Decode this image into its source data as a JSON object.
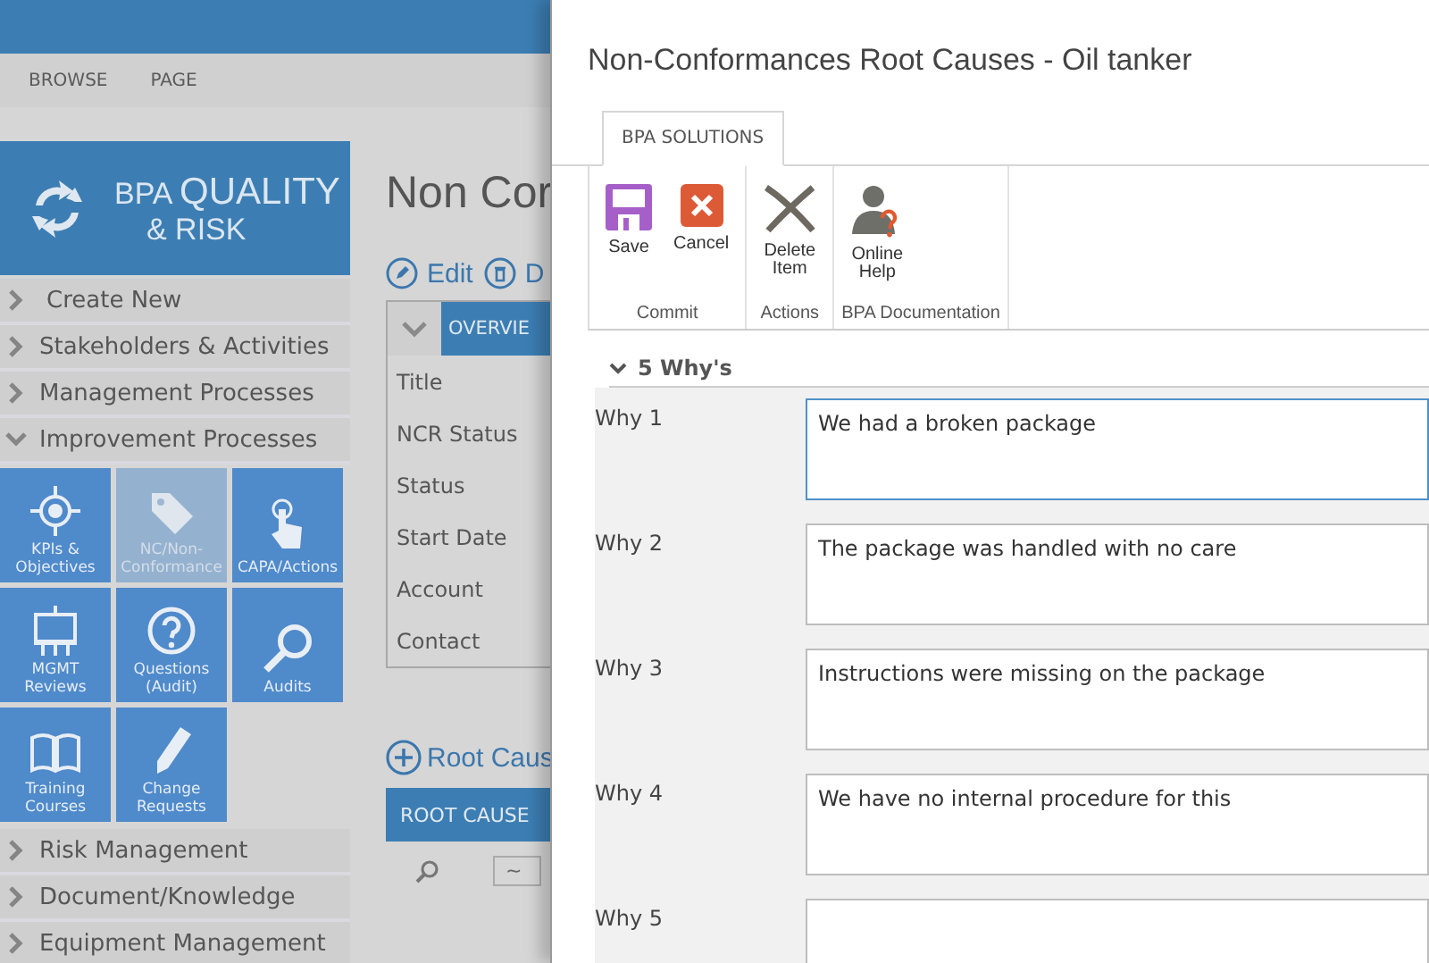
{
  "top_tabs": [
    "BROWSE",
    "PAGE"
  ],
  "logo": {
    "line1a": "BPA",
    "line1b": "QUALITY",
    "line2": "& RISK"
  },
  "nav_top": [
    {
      "label": "Create New",
      "expanded": false
    },
    {
      "label": "Stakeholders & Activities",
      "expanded": false
    },
    {
      "label": "Management Processes",
      "expanded": false
    },
    {
      "label": "Improvement Processes",
      "expanded": true
    }
  ],
  "tiles": [
    {
      "label": "KPIs & Objectives",
      "selected": false
    },
    {
      "label": "NC/Non-Conformance",
      "selected": true
    },
    {
      "label": "CAPA/Actions",
      "selected": false
    },
    {
      "label": "MGMT Reviews",
      "selected": false
    },
    {
      "label": "Questions (Audit)",
      "selected": false
    },
    {
      "label": "Audits",
      "selected": false
    },
    {
      "label": "Training Courses",
      "selected": false
    },
    {
      "label": "Change Requests",
      "selected": false
    }
  ],
  "nav_bottom": [
    {
      "label": "Risk Management",
      "expanded": false
    },
    {
      "label": "Document/Knowledge",
      "expanded": false
    },
    {
      "label": "Equipment Management",
      "expanded": false
    }
  ],
  "page": {
    "title": "Non Cor",
    "actions": [
      "Edit",
      "D"
    ],
    "section": "OVERVIE",
    "fields": [
      "Title",
      "NCR Status",
      "Status",
      "Start Date",
      "Account",
      "Contact"
    ],
    "add_link": "Root Caus",
    "list_header": "ROOT CAUSE",
    "filter_value": "~"
  },
  "dialog": {
    "title": "Non-Conformances Root Causes - Oil tanker",
    "ribbon_tab": "BPA SOLUTIONS",
    "groups": [
      {
        "label": "Commit",
        "buttons": [
          "Save",
          "Cancel"
        ]
      },
      {
        "label": "Actions",
        "buttons": [
          "Delete Item"
        ]
      },
      {
        "label": "BPA Documentation",
        "buttons": [
          "Online Help"
        ]
      }
    ],
    "section": "5 Why's",
    "whys": [
      {
        "label": "Why 1",
        "value": "We had a broken package",
        "selected": true
      },
      {
        "label": "Why 2",
        "value": "The package was handled with no care",
        "selected": false
      },
      {
        "label": "Why 3",
        "value": "Instructions were missing on the package",
        "selected": false
      },
      {
        "label": "Why 4",
        "value": "We have no internal procedure for this",
        "selected": false
      },
      {
        "label": "Why 5",
        "selected": false
      }
    ]
  }
}
